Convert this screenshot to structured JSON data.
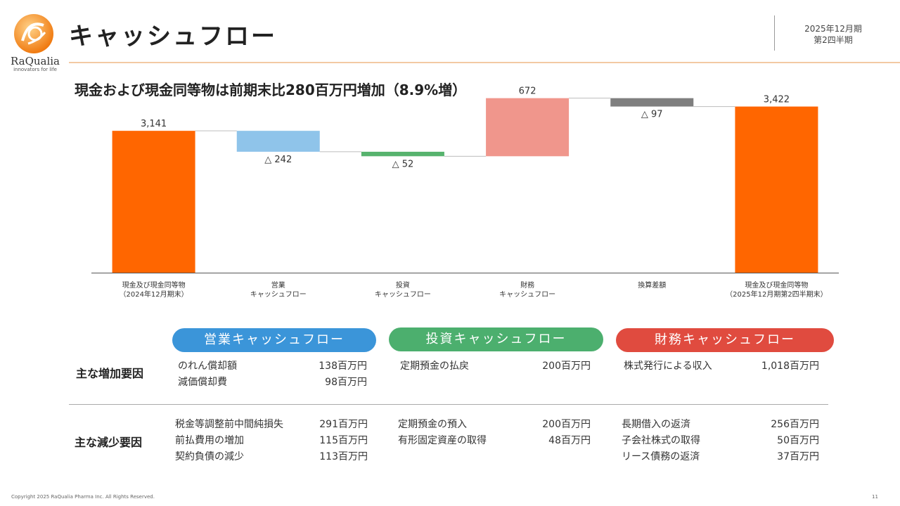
{
  "header": {
    "title": "キャッシュフロー",
    "logo_name": "RaQualia",
    "logo_tagline": "innovators for life",
    "period_line1": "2025年12月期",
    "period_line2": "第2四半期"
  },
  "subtitle": "現金および現金同等物は前期末比280百万円増加（8.9%増）",
  "colors": {
    "accent": "#ff6600",
    "operating": "#3b95d9",
    "investing": "#4caf6e",
    "financing": "#e04b3f"
  },
  "chart_data": {
    "type": "bar",
    "subtype": "waterfall",
    "categories": [
      [
        "現金及び現金同等物",
        "（2024年12月期末）"
      ],
      [
        "営業",
        "キャッシュフロー"
      ],
      [
        "投資",
        "キャッシュフロー"
      ],
      [
        "財務",
        "キャッシュフロー"
      ],
      [
        "換算差額"
      ],
      [
        "現金及び現金同等物",
        "（2025年12月期第2四半期末）"
      ]
    ],
    "values": [
      3141,
      -242,
      -52,
      672,
      -97,
      3422
    ],
    "labels": [
      "3,141",
      "△ 242",
      "△ 52",
      "672",
      "△ 97",
      "3,422"
    ],
    "kinds": [
      "total",
      "delta",
      "delta",
      "delta",
      "delta",
      "total"
    ],
    "bar_colors": [
      "#ff6600",
      "#8fc4ea",
      "#57b36e",
      "#f0968c",
      "#7f7f7f",
      "#ff6600"
    ],
    "ylim": [
      1500,
      3500
    ],
    "grid": false,
    "legend": "none"
  },
  "factors": {
    "increase_heading": "主な増加要因",
    "decrease_heading": "主な減少要因",
    "operating": {
      "label": "営業キャッシュフロー",
      "increase": [
        {
          "item": "のれん償却額",
          "amount": "138百万円"
        },
        {
          "item": "減価償却費",
          "amount": "98百万円"
        }
      ],
      "decrease": [
        {
          "item": "税金等調整前中間純損失",
          "amount": "291百万円"
        },
        {
          "item": "前払費用の増加",
          "amount": "115百万円"
        },
        {
          "item": "契約負債の減少",
          "amount": "113百万円"
        }
      ]
    },
    "investing": {
      "label": "投資キャッシュフロー",
      "increase": [
        {
          "item": "定期預金の払戻",
          "amount": "200百万円"
        }
      ],
      "decrease": [
        {
          "item": "定期預金の預入",
          "amount": "200百万円"
        },
        {
          "item": "有形固定資産の取得",
          "amount": "48百万円"
        }
      ]
    },
    "financing": {
      "label": "財務キャッシュフロー",
      "increase": [
        {
          "item": "株式発行による収入",
          "amount": "1,018百万円"
        }
      ],
      "decrease": [
        {
          "item": "長期借入の返済",
          "amount": "256百万円"
        },
        {
          "item": "子会社株式の取得",
          "amount": "50百万円"
        },
        {
          "item": "リース債務の返済",
          "amount": "37百万円"
        }
      ]
    }
  },
  "footer": {
    "copyright": "Copyright 2025 RaQualia Pharma Inc. All Rights Reserved.",
    "page": "11"
  }
}
